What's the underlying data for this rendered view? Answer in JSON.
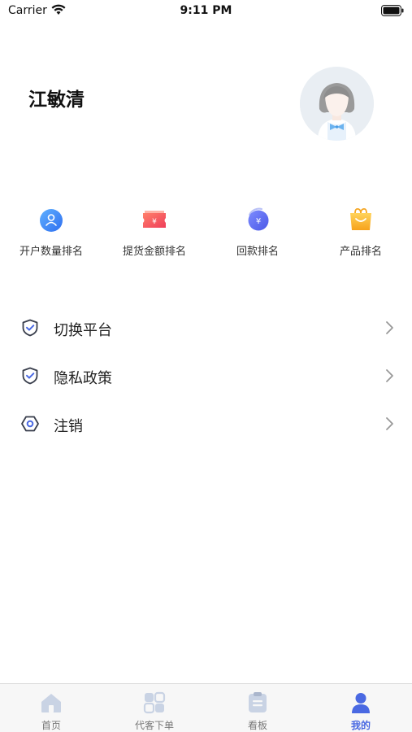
{
  "status_bar": {
    "carrier": "Carrier",
    "time": "9:11 PM"
  },
  "profile": {
    "name": "江敏清",
    "avatar_icon": "user-avatar-icon"
  },
  "rankings": [
    {
      "label": "开户数量排名",
      "icon": "account-rank-icon",
      "color": "#3b86f5"
    },
    {
      "label": "提货金额排名",
      "icon": "coupon-rank-icon",
      "color": "#f45a5a"
    },
    {
      "label": "回款排名",
      "icon": "payment-rank-icon",
      "color": "#5b6ff2"
    },
    {
      "label": "产品排名",
      "icon": "gift-rank-icon",
      "color": "#f9b437"
    }
  ],
  "menu": [
    {
      "label": "切换平台",
      "icon": "shield-check-icon"
    },
    {
      "label": "隐私政策",
      "icon": "shield-check-icon"
    },
    {
      "label": "注销",
      "icon": "hexagon-icon"
    }
  ],
  "tabs": [
    {
      "label": "首页",
      "icon": "home-icon",
      "active": false
    },
    {
      "label": "代客下单",
      "icon": "grid-order-icon",
      "active": false
    },
    {
      "label": "看板",
      "icon": "board-icon",
      "active": false
    },
    {
      "label": "我的",
      "icon": "profile-icon",
      "active": true
    }
  ],
  "colors": {
    "accent": "#4a69e2",
    "tab_inactive_icon": "#c9d3e4"
  }
}
